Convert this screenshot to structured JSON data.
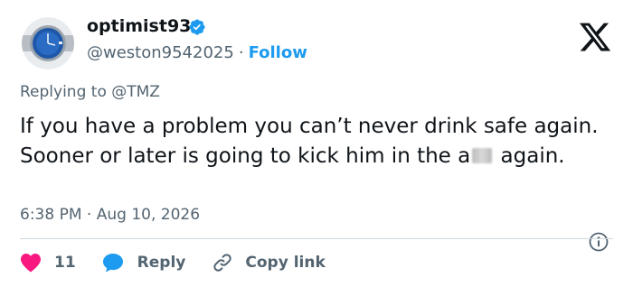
{
  "user": {
    "display_name": "optimist93",
    "handle": "@weston9542025",
    "separator": "·",
    "follow_label": "Follow"
  },
  "reply_context": {
    "prefix": "Replying to",
    "mention": "@TMZ"
  },
  "tweet": {
    "text_part1": "If you have a problem you can’t never drink safe again. Sooner or later is going to kick him in the a",
    "text_part2": " again.",
    "time": "6:38 PM",
    "separator": "·",
    "date": "Aug 10, 2026"
  },
  "actions": {
    "like_count": "11",
    "reply_label": "Reply",
    "copy_link_label": "Copy link"
  },
  "colors": {
    "accent": "#1d9bf0",
    "like": "#f91880",
    "text": "#0f1419",
    "muted": "#536471"
  },
  "icons": [
    "verified-badge-icon",
    "x-logo-icon",
    "info-icon",
    "heart-icon",
    "reply-bubble-icon",
    "link-icon"
  ]
}
